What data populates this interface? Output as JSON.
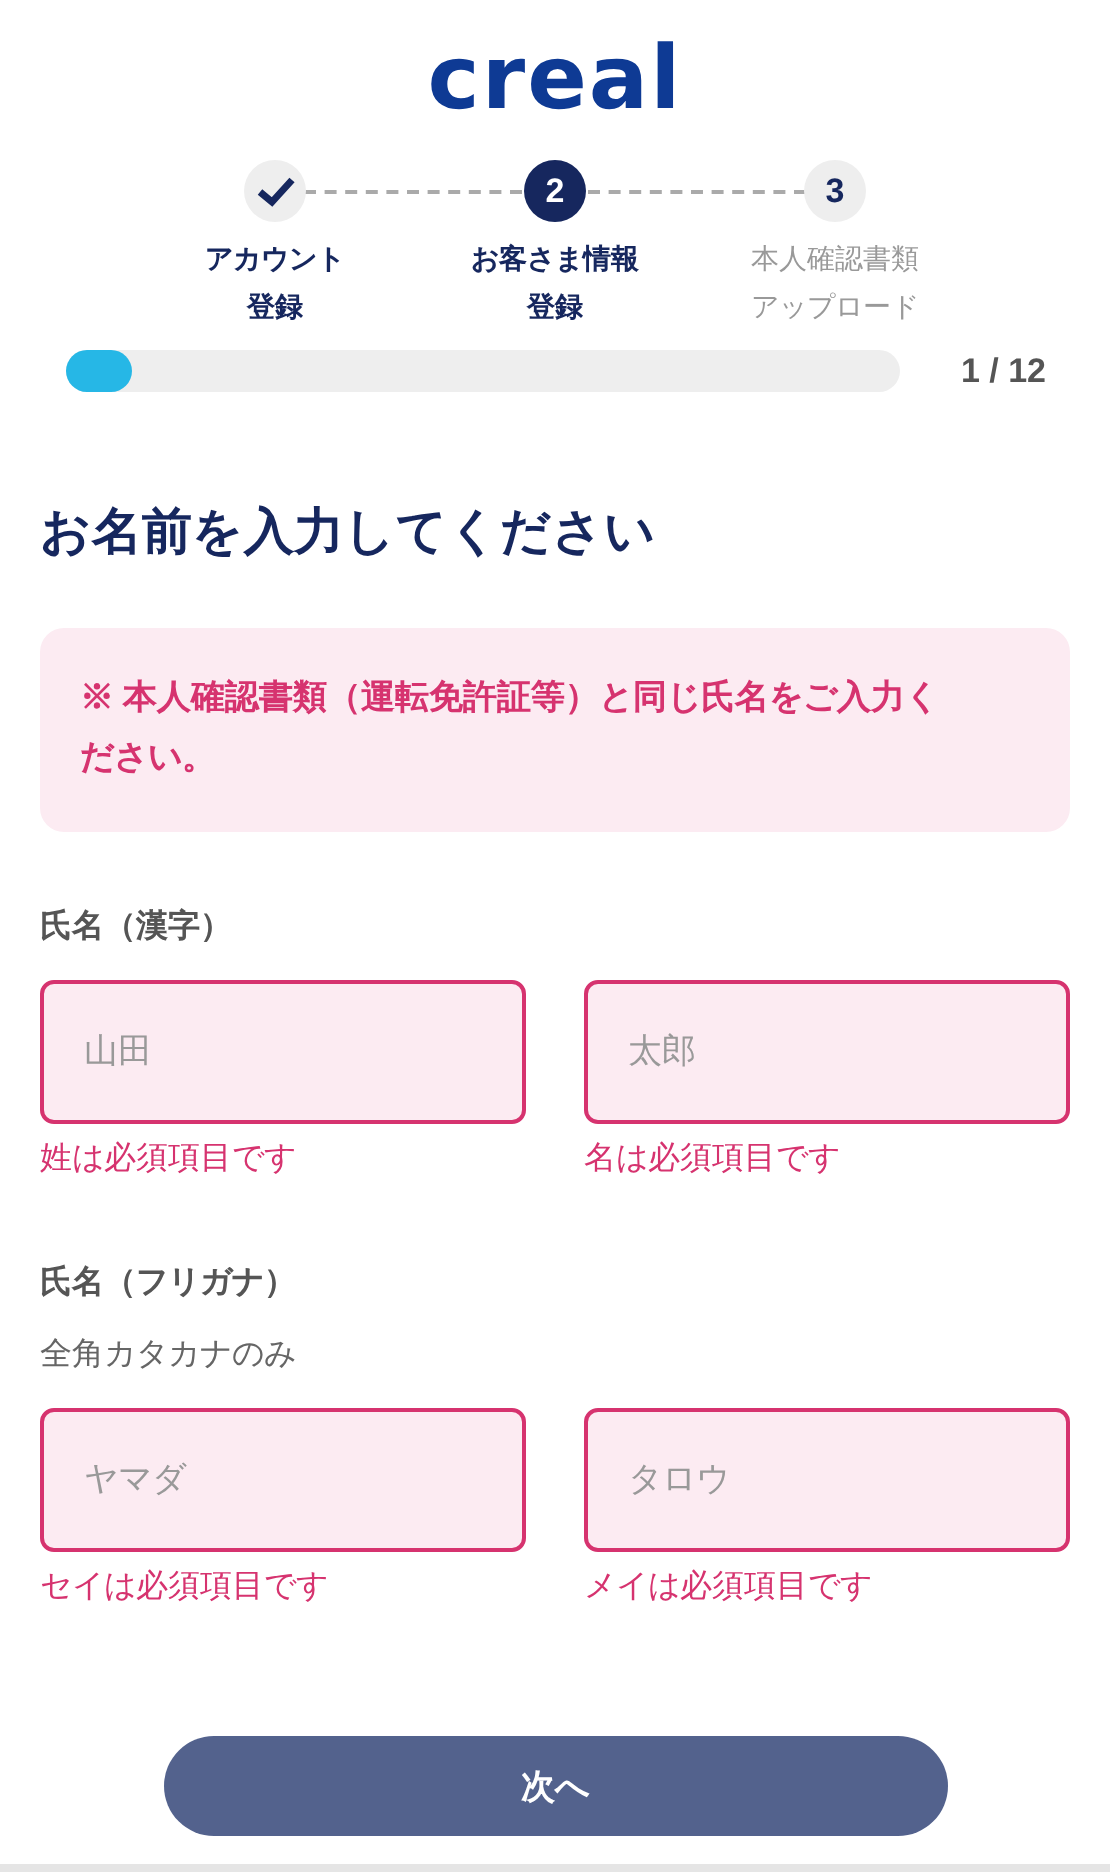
{
  "logo": "creal",
  "steps": [
    {
      "completed": true,
      "selected": false,
      "label": [
        "アカウント",
        "登録"
      ]
    },
    {
      "completed": false,
      "selected": true,
      "number": "2",
      "label": [
        "お客さま情報",
        "登録"
      ]
    },
    {
      "completed": false,
      "selected": false,
      "number": "3",
      "label": [
        "本人確認書類",
        "アップロード"
      ]
    }
  ],
  "progress": {
    "level": 0.08,
    "reading": "1 / 12"
  },
  "heading": "お名前を入力してください",
  "notice": "※ 本人確認書類（運転免許証等）と同じ氏名をご入力ください。",
  "groups": [
    {
      "label": "氏名（漢字）",
      "fields": [
        {
          "placeholder": "山田",
          "invalid": true,
          "error": "姓は必須項目です"
        },
        {
          "placeholder": "太郎",
          "invalid": true,
          "error": "名は必須項目です"
        }
      ]
    },
    {
      "label": "氏名（フリガナ）",
      "hint": "全角カタカナのみ",
      "fields": [
        {
          "placeholder": "ヤマダ",
          "invalid": true,
          "error": "セイは必須項目です"
        },
        {
          "placeholder": "タロウ",
          "invalid": true,
          "error": "メイは必須項目です"
        }
      ]
    }
  ],
  "next_button": {
    "label": "次へ",
    "disabled": true
  }
}
